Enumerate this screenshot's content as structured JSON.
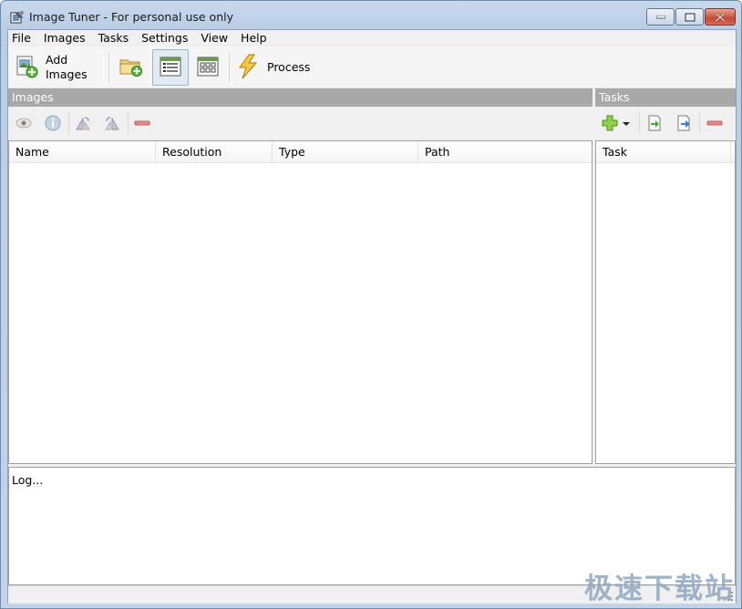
{
  "window": {
    "title": "Image Tuner - For personal use only",
    "icon": "app-icon"
  },
  "menu": [
    "File",
    "Images",
    "Tasks",
    "Settings",
    "View",
    "Help"
  ],
  "toolbar": {
    "add_images_line1": "Add",
    "add_images_line2": "Images",
    "process_label": "Process"
  },
  "images_panel": {
    "header": "Images",
    "columns": [
      "Name",
      "Resolution",
      "Type",
      "Path"
    ]
  },
  "tasks_panel": {
    "header": "Tasks",
    "columns": [
      "Task"
    ]
  },
  "log": {
    "text": "Log..."
  },
  "watermark": "极速下载站",
  "colors": {
    "accent": "#9bb5cf",
    "panel_header": "#a8a8a8"
  }
}
